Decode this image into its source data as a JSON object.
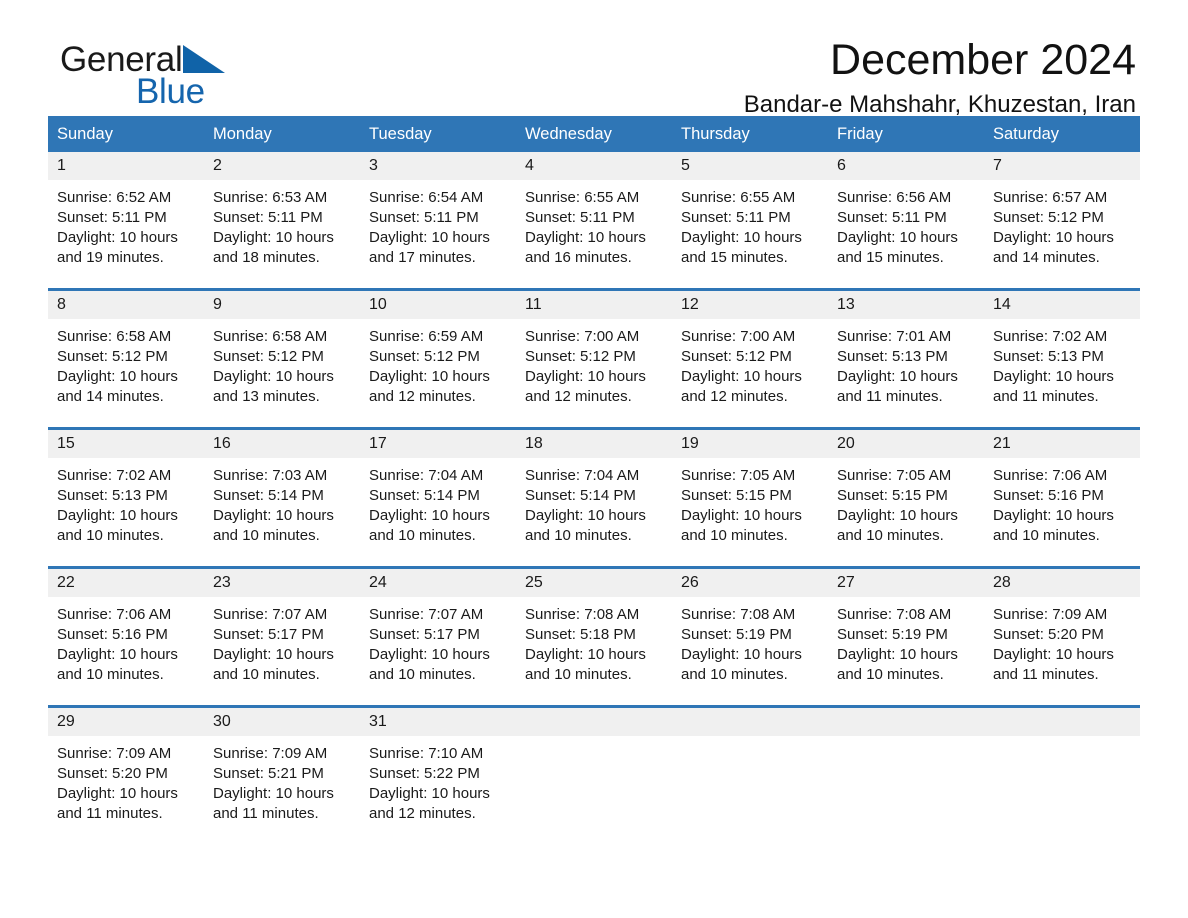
{
  "brand": {
    "name_part1": "General",
    "name_part2": "Blue",
    "logo_icon": "triangle-play-icon",
    "accent_color": "#1565ad"
  },
  "header": {
    "title": "December 2024",
    "subtitle": "Bandar-e Mahshahr, Khuzestan, Iran"
  },
  "calendar": {
    "header_bg_color": "#2f76b6",
    "daynum_bg_color": "#f0f0f0",
    "weekday_headers": [
      "Sunday",
      "Monday",
      "Tuesday",
      "Wednesday",
      "Thursday",
      "Friday",
      "Saturday"
    ],
    "weeks": [
      [
        {
          "day": "1",
          "sunrise": "Sunrise: 6:52 AM",
          "sunset": "Sunset: 5:11 PM",
          "daylight_line1": "Daylight: 10 hours",
          "daylight_line2": "and 19 minutes."
        },
        {
          "day": "2",
          "sunrise": "Sunrise: 6:53 AM",
          "sunset": "Sunset: 5:11 PM",
          "daylight_line1": "Daylight: 10 hours",
          "daylight_line2": "and 18 minutes."
        },
        {
          "day": "3",
          "sunrise": "Sunrise: 6:54 AM",
          "sunset": "Sunset: 5:11 PM",
          "daylight_line1": "Daylight: 10 hours",
          "daylight_line2": "and 17 minutes."
        },
        {
          "day": "4",
          "sunrise": "Sunrise: 6:55 AM",
          "sunset": "Sunset: 5:11 PM",
          "daylight_line1": "Daylight: 10 hours",
          "daylight_line2": "and 16 minutes."
        },
        {
          "day": "5",
          "sunrise": "Sunrise: 6:55 AM",
          "sunset": "Sunset: 5:11 PM",
          "daylight_line1": "Daylight: 10 hours",
          "daylight_line2": "and 15 minutes."
        },
        {
          "day": "6",
          "sunrise": "Sunrise: 6:56 AM",
          "sunset": "Sunset: 5:11 PM",
          "daylight_line1": "Daylight: 10 hours",
          "daylight_line2": "and 15 minutes."
        },
        {
          "day": "7",
          "sunrise": "Sunrise: 6:57 AM",
          "sunset": "Sunset: 5:12 PM",
          "daylight_line1": "Daylight: 10 hours",
          "daylight_line2": "and 14 minutes."
        }
      ],
      [
        {
          "day": "8",
          "sunrise": "Sunrise: 6:58 AM",
          "sunset": "Sunset: 5:12 PM",
          "daylight_line1": "Daylight: 10 hours",
          "daylight_line2": "and 14 minutes."
        },
        {
          "day": "9",
          "sunrise": "Sunrise: 6:58 AM",
          "sunset": "Sunset: 5:12 PM",
          "daylight_line1": "Daylight: 10 hours",
          "daylight_line2": "and 13 minutes."
        },
        {
          "day": "10",
          "sunrise": "Sunrise: 6:59 AM",
          "sunset": "Sunset: 5:12 PM",
          "daylight_line1": "Daylight: 10 hours",
          "daylight_line2": "and 12 minutes."
        },
        {
          "day": "11",
          "sunrise": "Sunrise: 7:00 AM",
          "sunset": "Sunset: 5:12 PM",
          "daylight_line1": "Daylight: 10 hours",
          "daylight_line2": "and 12 minutes."
        },
        {
          "day": "12",
          "sunrise": "Sunrise: 7:00 AM",
          "sunset": "Sunset: 5:12 PM",
          "daylight_line1": "Daylight: 10 hours",
          "daylight_line2": "and 12 minutes."
        },
        {
          "day": "13",
          "sunrise": "Sunrise: 7:01 AM",
          "sunset": "Sunset: 5:13 PM",
          "daylight_line1": "Daylight: 10 hours",
          "daylight_line2": "and 11 minutes."
        },
        {
          "day": "14",
          "sunrise": "Sunrise: 7:02 AM",
          "sunset": "Sunset: 5:13 PM",
          "daylight_line1": "Daylight: 10 hours",
          "daylight_line2": "and 11 minutes."
        }
      ],
      [
        {
          "day": "15",
          "sunrise": "Sunrise: 7:02 AM",
          "sunset": "Sunset: 5:13 PM",
          "daylight_line1": "Daylight: 10 hours",
          "daylight_line2": "and 10 minutes."
        },
        {
          "day": "16",
          "sunrise": "Sunrise: 7:03 AM",
          "sunset": "Sunset: 5:14 PM",
          "daylight_line1": "Daylight: 10 hours",
          "daylight_line2": "and 10 minutes."
        },
        {
          "day": "17",
          "sunrise": "Sunrise: 7:04 AM",
          "sunset": "Sunset: 5:14 PM",
          "daylight_line1": "Daylight: 10 hours",
          "daylight_line2": "and 10 minutes."
        },
        {
          "day": "18",
          "sunrise": "Sunrise: 7:04 AM",
          "sunset": "Sunset: 5:14 PM",
          "daylight_line1": "Daylight: 10 hours",
          "daylight_line2": "and 10 minutes."
        },
        {
          "day": "19",
          "sunrise": "Sunrise: 7:05 AM",
          "sunset": "Sunset: 5:15 PM",
          "daylight_line1": "Daylight: 10 hours",
          "daylight_line2": "and 10 minutes."
        },
        {
          "day": "20",
          "sunrise": "Sunrise: 7:05 AM",
          "sunset": "Sunset: 5:15 PM",
          "daylight_line1": "Daylight: 10 hours",
          "daylight_line2": "and 10 minutes."
        },
        {
          "day": "21",
          "sunrise": "Sunrise: 7:06 AM",
          "sunset": "Sunset: 5:16 PM",
          "daylight_line1": "Daylight: 10 hours",
          "daylight_line2": "and 10 minutes."
        }
      ],
      [
        {
          "day": "22",
          "sunrise": "Sunrise: 7:06 AM",
          "sunset": "Sunset: 5:16 PM",
          "daylight_line1": "Daylight: 10 hours",
          "daylight_line2": "and 10 minutes."
        },
        {
          "day": "23",
          "sunrise": "Sunrise: 7:07 AM",
          "sunset": "Sunset: 5:17 PM",
          "daylight_line1": "Daylight: 10 hours",
          "daylight_line2": "and 10 minutes."
        },
        {
          "day": "24",
          "sunrise": "Sunrise: 7:07 AM",
          "sunset": "Sunset: 5:17 PM",
          "daylight_line1": "Daylight: 10 hours",
          "daylight_line2": "and 10 minutes."
        },
        {
          "day": "25",
          "sunrise": "Sunrise: 7:08 AM",
          "sunset": "Sunset: 5:18 PM",
          "daylight_line1": "Daylight: 10 hours",
          "daylight_line2": "and 10 minutes."
        },
        {
          "day": "26",
          "sunrise": "Sunrise: 7:08 AM",
          "sunset": "Sunset: 5:19 PM",
          "daylight_line1": "Daylight: 10 hours",
          "daylight_line2": "and 10 minutes."
        },
        {
          "day": "27",
          "sunrise": "Sunrise: 7:08 AM",
          "sunset": "Sunset: 5:19 PM",
          "daylight_line1": "Daylight: 10 hours",
          "daylight_line2": "and 10 minutes."
        },
        {
          "day": "28",
          "sunrise": "Sunrise: 7:09 AM",
          "sunset": "Sunset: 5:20 PM",
          "daylight_line1": "Daylight: 10 hours",
          "daylight_line2": "and 11 minutes."
        }
      ],
      [
        {
          "day": "29",
          "sunrise": "Sunrise: 7:09 AM",
          "sunset": "Sunset: 5:20 PM",
          "daylight_line1": "Daylight: 10 hours",
          "daylight_line2": "and 11 minutes."
        },
        {
          "day": "30",
          "sunrise": "Sunrise: 7:09 AM",
          "sunset": "Sunset: 5:21 PM",
          "daylight_line1": "Daylight: 10 hours",
          "daylight_line2": "and 11 minutes."
        },
        {
          "day": "31",
          "sunrise": "Sunrise: 7:10 AM",
          "sunset": "Sunset: 5:22 PM",
          "daylight_line1": "Daylight: 10 hours",
          "daylight_line2": "and 12 minutes."
        },
        {
          "day": "",
          "sunrise": "",
          "sunset": "",
          "daylight_line1": "",
          "daylight_line2": ""
        },
        {
          "day": "",
          "sunrise": "",
          "sunset": "",
          "daylight_line1": "",
          "daylight_line2": ""
        },
        {
          "day": "",
          "sunrise": "",
          "sunset": "",
          "daylight_line1": "",
          "daylight_line2": ""
        },
        {
          "day": "",
          "sunrise": "",
          "sunset": "",
          "daylight_line1": "",
          "daylight_line2": ""
        }
      ]
    ]
  }
}
